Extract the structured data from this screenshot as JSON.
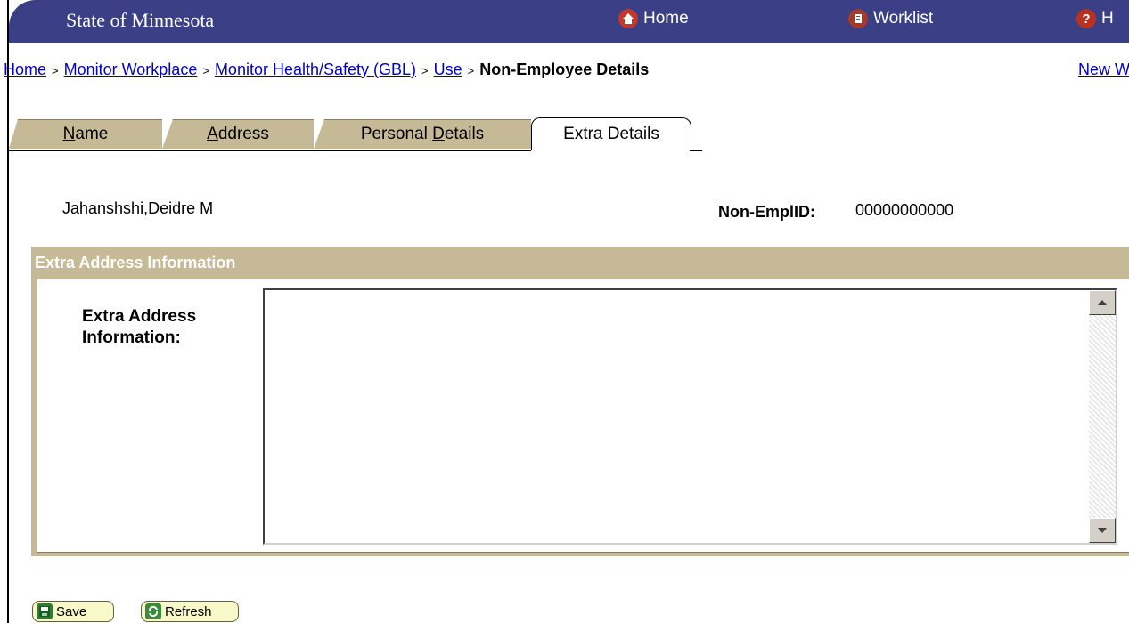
{
  "header": {
    "org_name": "State of Minnesota",
    "links": [
      {
        "label": "Home",
        "icon": "home-icon"
      },
      {
        "label": "Worklist",
        "icon": "worklist-icon"
      },
      {
        "label": "H",
        "icon": "help-icon"
      }
    ]
  },
  "breadcrumb": {
    "items": [
      "Home",
      "Monitor Workplace",
      "Monitor Health/Safety (GBL)",
      "Use"
    ],
    "current": "Non-Employee Details",
    "separator": ">"
  },
  "new_window_label": "New W",
  "tabs": [
    {
      "pre": "",
      "u": "N",
      "post": "ame"
    },
    {
      "pre": "",
      "u": "A",
      "post": "ddress"
    },
    {
      "pre": "Personal ",
      "u": "D",
      "post": "etails"
    },
    {
      "label": "Extra Details",
      "active": true
    }
  ],
  "person": {
    "name": "Jahanshshi,Deidre M",
    "id_label": "Non-EmplID:",
    "id_value": "00000000000"
  },
  "group": {
    "title": "Extra Address Information",
    "field_label": "Extra Address Information:",
    "field_value": ""
  },
  "buttons": {
    "save": "Save",
    "refresh": "Refresh"
  },
  "colors": {
    "header_bg": "#3b3f86",
    "tab_bg": "#c6b995",
    "link": "#0000cc",
    "button_bg": "#f8f8c8"
  }
}
